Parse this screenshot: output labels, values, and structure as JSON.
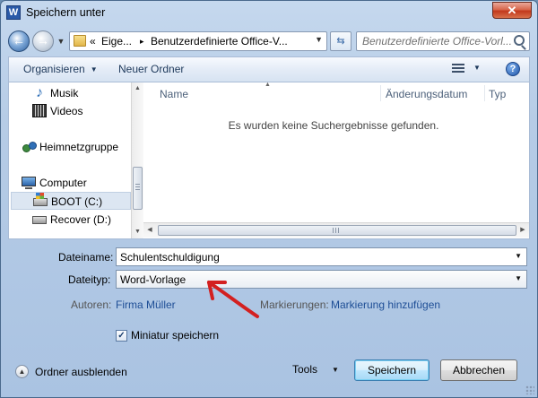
{
  "window": {
    "title": "Speichern unter",
    "app_icon_letter": "W",
    "close_glyph": "✕"
  },
  "address": {
    "chevron": "«",
    "segments": [
      "Eige...",
      "Benutzerdefinierte Office-V..."
    ],
    "separator": "▸"
  },
  "search": {
    "placeholder": "Benutzerdefinierte Office-Vorl..."
  },
  "toolbar": {
    "organize": "Organisieren",
    "new_folder": "Neuer Ordner",
    "help": "?"
  },
  "navigation": {
    "items": [
      {
        "label": "Musik",
        "icon": "music-icon"
      },
      {
        "label": "Videos",
        "icon": "video-icon"
      },
      {
        "label": "Heimnetzgruppe",
        "icon": "homegroup-icon"
      },
      {
        "label": "Computer",
        "icon": "computer-icon"
      },
      {
        "label": "BOOT (C:)",
        "icon": "system-drive-icon",
        "selected": true
      },
      {
        "label": "Recover (D:)",
        "icon": "drive-icon"
      }
    ]
  },
  "file_list": {
    "columns": [
      "Name",
      "Änderungsdatum",
      "Typ"
    ],
    "empty_message": "Es wurden keine Suchergebnisse gefunden."
  },
  "form": {
    "filename_label": "Dateiname:",
    "filename_value": "Schulentschuldigung",
    "filetype_label": "Dateityp:",
    "filetype_value": "Word-Vorlage",
    "authors_label": "Autoren:",
    "authors_value": "Firma Müller",
    "tags_label": "Markierungen:",
    "tags_value": "Markierung hinzufügen",
    "thumbnail_label": "Miniatur speichern",
    "thumbnail_checked": true
  },
  "footer": {
    "hide_folders": "Ordner ausblenden",
    "tools": "Tools",
    "save": "Speichern",
    "cancel": "Abbrechen"
  },
  "colors": {
    "annotation_arrow": "#d32020",
    "link": "#1e4e96"
  }
}
